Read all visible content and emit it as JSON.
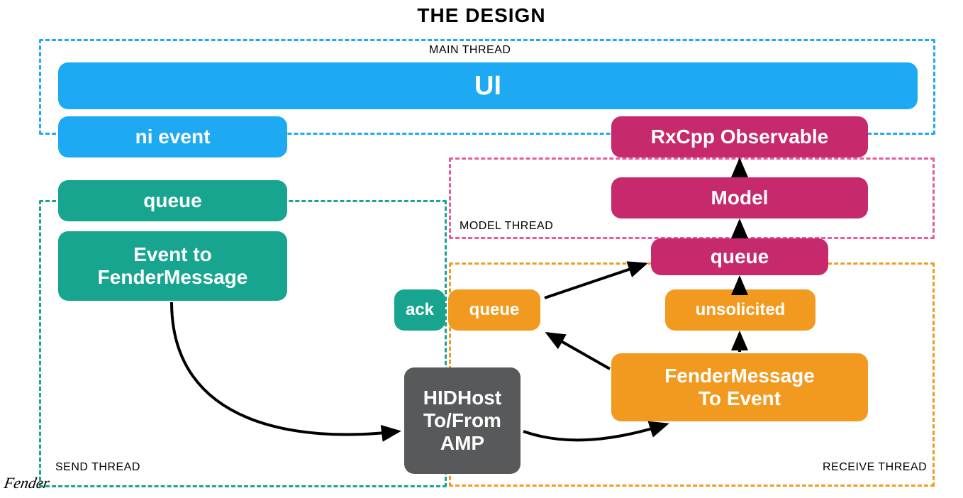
{
  "title": "THE DESIGN",
  "threads": {
    "main": {
      "label": "MAIN THREAD",
      "color": "#1ea9f3"
    },
    "send": {
      "label": "SEND THREAD",
      "color": "#17a58f"
    },
    "model": {
      "label": "MODEL THREAD",
      "color": "#e85a9b"
    },
    "receive": {
      "label": "RECEIVE THREAD",
      "color": "#f29a1f"
    }
  },
  "nodes": {
    "ui": {
      "label": "UI",
      "color": "blue"
    },
    "ni_event": {
      "label": "ni event",
      "color": "blue"
    },
    "queue_send": {
      "label": "queue",
      "color": "teal"
    },
    "event_to_fm": {
      "label": "Event to\nFenderMessage",
      "color": "teal"
    },
    "ack": {
      "label": "ack",
      "color": "teal"
    },
    "rx_observable": {
      "label": "RxCpp Observable",
      "color": "pink"
    },
    "model": {
      "label": "Model",
      "color": "pink"
    },
    "queue_model": {
      "label": "queue",
      "color": "pink"
    },
    "queue_recv": {
      "label": "queue",
      "color": "orange"
    },
    "unsolicited": {
      "label": "unsolicited",
      "color": "orange"
    },
    "fm_to_event": {
      "label": "FenderMessage\nTo Event",
      "color": "orange"
    },
    "hidhost": {
      "label": "HIDHost\nTo/From\nAMP",
      "color": "gray"
    }
  },
  "edges": [
    {
      "from": "event_to_fm",
      "to": "hidhost"
    },
    {
      "from": "hidhost",
      "to": "fm_to_event"
    },
    {
      "from": "fm_to_event",
      "to": "unsolicited"
    },
    {
      "from": "fm_to_event",
      "to": "queue_recv"
    },
    {
      "from": "unsolicited",
      "to": "queue_model"
    },
    {
      "from": "queue_recv",
      "to": "queue_model"
    },
    {
      "from": "queue_model",
      "to": "model"
    },
    {
      "from": "model",
      "to": "rx_observable"
    }
  ],
  "logo": "Fender"
}
